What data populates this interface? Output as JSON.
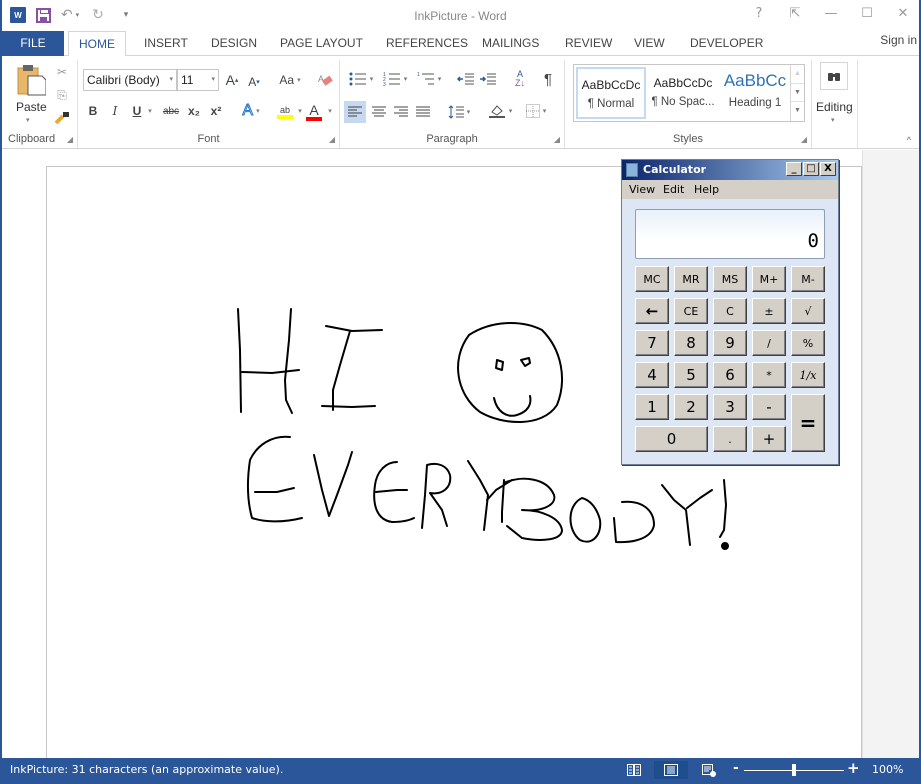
{
  "app": {
    "title": "InkPicture - Word",
    "icons": {
      "app": "word-logo-icon",
      "save": "save-icon",
      "undo": "undo-icon",
      "redo": "redo-icon",
      "customize": "customize-qat-icon"
    }
  },
  "window_controls": {
    "help": "?",
    "ribbon_display": "⇱",
    "minimize": "—",
    "maximize": "☐",
    "close": "✕"
  },
  "tabs": [
    {
      "label": "FILE"
    },
    {
      "label": "HOME",
      "active": true
    },
    {
      "label": "INSERT"
    },
    {
      "label": "DESIGN"
    },
    {
      "label": "PAGE LAYOUT"
    },
    {
      "label": "REFERENCES"
    },
    {
      "label": "MAILINGS"
    },
    {
      "label": "REVIEW"
    },
    {
      "label": "VIEW"
    },
    {
      "label": "DEVELOPER"
    }
  ],
  "sign_in": "Sign in",
  "ribbon": {
    "clipboard": {
      "label": "Clipboard",
      "paste": "Paste"
    },
    "font": {
      "label": "Font",
      "font_name": "Calibri (Body)",
      "font_size": "11",
      "change_case": "Aa",
      "bold": "B",
      "italic": "I",
      "underline": "U",
      "strikethrough": "abc",
      "subscript": "x₂",
      "superscript": "x²",
      "text_effects": "A",
      "highlight": "ab",
      "font_color": "A",
      "highlight_color": "#ffff00",
      "font_color_value": "#ff0000"
    },
    "paragraph": {
      "label": "Paragraph",
      "show_marks": "¶"
    },
    "styles": {
      "label": "Styles",
      "items": [
        {
          "sample": "AaBbCcDc",
          "name": "¶ Normal",
          "selected": true
        },
        {
          "sample": "AaBbCcDc",
          "name": "¶ No Spac..."
        },
        {
          "sample": "AaBbCc",
          "name": "Heading 1"
        }
      ]
    },
    "editing": {
      "label": "Editing"
    }
  },
  "document": {
    "ink_text": "HI ☺ EVERYBODY!"
  },
  "calculator": {
    "title": "Calculator",
    "menu": [
      "View",
      "Edit",
      "Help"
    ],
    "display": "0",
    "title_buttons": [
      "_",
      "□",
      "X"
    ],
    "rows": [
      [
        "MC",
        "MR",
        "MS",
        "M+",
        "M-"
      ],
      [
        "←",
        "CE",
        "C",
        "±",
        "√"
      ],
      [
        "7",
        "8",
        "9",
        "/",
        "%"
      ],
      [
        "4",
        "5",
        "6",
        "*",
        "1/x"
      ],
      [
        "1",
        "2",
        "3",
        "-",
        "="
      ],
      [
        "0",
        ".",
        "+"
      ]
    ]
  },
  "statusbar": {
    "text": "InkPicture: 31 characters (an approximate value).",
    "zoom_level": "100%",
    "zoom_percent": 100,
    "views": [
      "read-mode-icon",
      "print-layout-icon",
      "web-layout-icon"
    ],
    "active_view": "print-layout"
  }
}
